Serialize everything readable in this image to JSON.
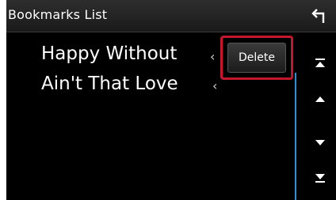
{
  "header": {
    "title": "Bookmarks List",
    "back_icon": "back-arrow-icon"
  },
  "list": {
    "items": [
      {
        "label": "Happy Without"
      },
      {
        "label": "Ain't That Love"
      }
    ]
  },
  "actions": {
    "delete_label": "Delete",
    "highlight_color": "#c4162c"
  },
  "scroll": {
    "buttons": [
      "scroll-top-icon",
      "scroll-up-icon",
      "scroll-down-icon",
      "scroll-bottom-icon"
    ],
    "accent_color": "#2a8fd6"
  }
}
